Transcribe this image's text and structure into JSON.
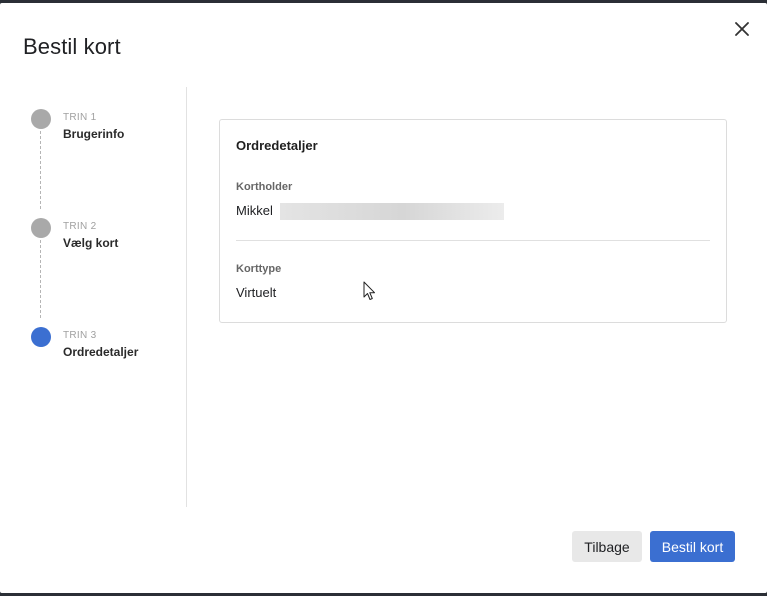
{
  "dialog": {
    "title": "Bestil kort"
  },
  "steps": [
    {
      "kicker": "TRIN 1",
      "label": "Brugerinfo",
      "state": "done"
    },
    {
      "kicker": "TRIN 2",
      "label": "Vælg kort",
      "state": "done"
    },
    {
      "kicker": "TRIN 3",
      "label": "Ordredetaljer",
      "state": "active"
    }
  ],
  "order": {
    "heading": "Ordredetaljer",
    "cardholder_label": "Kortholder",
    "cardholder_value": "Mikkel",
    "cardtype_label": "Korttype",
    "cardtype_value": "Virtuelt"
  },
  "footer": {
    "back_label": "Tilbage",
    "submit_label": "Bestil kort"
  },
  "colors": {
    "accent": "#3b6fd1",
    "step_done": "#a9a9a9"
  },
  "icons": {
    "close": "close-icon",
    "cursor": "mouse-pointer-icon"
  }
}
